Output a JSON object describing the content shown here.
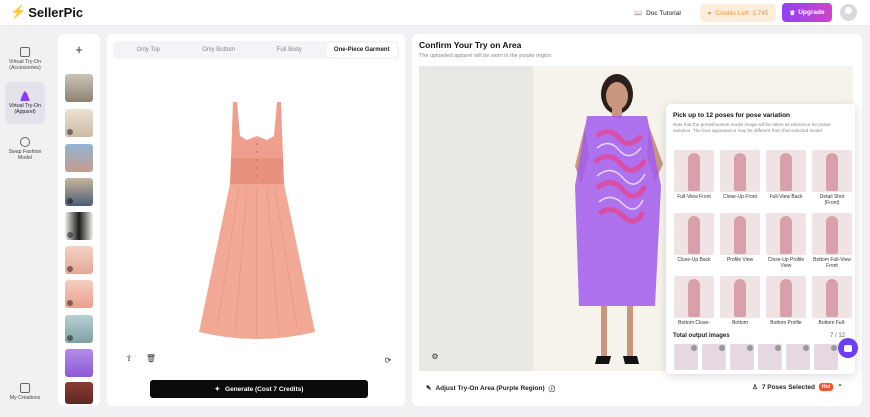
{
  "header": {
    "logo_text": "SellerPic",
    "doc_tutorial": "Doc Tutorial",
    "credits": "Credits Left: 1,745",
    "upgrade": "Upgrade"
  },
  "sidebar": {
    "items": [
      {
        "label": "Virtual Try-On (Accessories)"
      },
      {
        "label": "Virtual Try-On (Apparel)"
      },
      {
        "label": "Swap Fashion Model"
      }
    ],
    "bottom_label": "My Creations"
  },
  "garment_tabs": [
    "Only Top",
    "Only Bottom",
    "Full Body",
    "One-Piece Garment"
  ],
  "generate_label": "Generate (Cost 7 Credits)",
  "tryon": {
    "title": "Confirm Your Try on Area",
    "subtitle": "The uploaded apparel will be worn in the purple region",
    "adjust_label": "Adjust Try-On Area (Purple Region)",
    "poses_selected": "7 Poses Selected",
    "hot_badge": "Hot"
  },
  "poses": {
    "title": "Pick up to 12 poses for pose variation",
    "note": "Note that the preset/custom model image will be taken as reference for poses variation. The face appearance may be different from that selected model",
    "items": [
      "Full-View Front",
      "Close-Up Front",
      "Full-View Back",
      "Detail Shot (Front)",
      "Close-Up Back",
      "Profile View",
      "Close-Up Profile View",
      "Bottom Full-View Front",
      "Bottom Close-",
      "Bottom",
      "Bottom Profile",
      "Bottom Full-"
    ],
    "total_label": "Total output images",
    "total_count": "7 / 12"
  },
  "colors": {
    "accent": "#8b3cf6",
    "dress": "#eea08c",
    "tryon_region": "#a25cf0"
  }
}
